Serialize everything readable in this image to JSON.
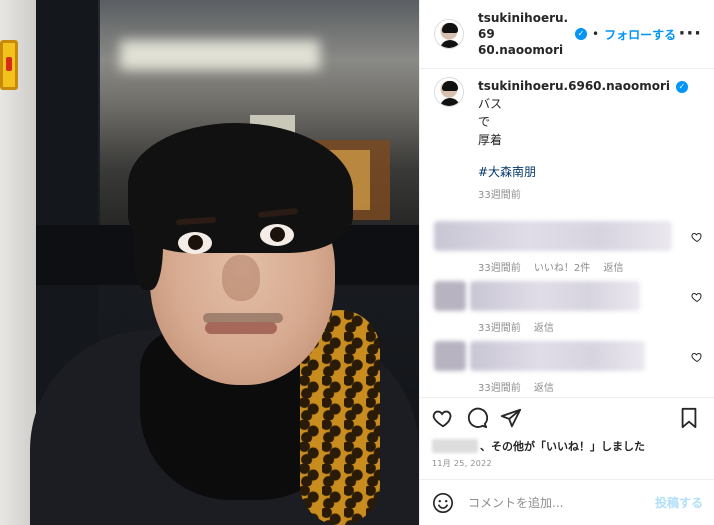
{
  "header": {
    "username_line1": "tsukinihoeru.69",
    "username_line2": "60.naoomori",
    "separator": "•",
    "follow_label": "フォローする",
    "more_label": "···"
  },
  "caption": {
    "username": "tsukinihoeru.6960.naoomori",
    "text_line1": "バス",
    "text_line2": "で",
    "text_line3": "厚着",
    "hashtag": "#大森南朋",
    "time": "33週間前"
  },
  "comments": [
    {
      "time": "33週間前",
      "likes": "いいね！2件",
      "reply": "返信"
    },
    {
      "time": "33週間前",
      "reply": "返信"
    },
    {
      "time": "33週間前",
      "reply": "返信"
    }
  ],
  "likes": {
    "text": "、その他が「いいね！」しました"
  },
  "date": "11月 25, 2022",
  "add_comment": {
    "placeholder": "コメントを追加...",
    "post_label": "投稿する"
  },
  "colors": {
    "accent": "#0095f6",
    "hashtag": "#00376b",
    "muted": "#8e8e8e",
    "post_disabled": "#b2dffc"
  },
  "icons": [
    "verified-badge-icon",
    "more-icon",
    "heart-icon",
    "comment-icon",
    "share-icon",
    "save-icon",
    "emoji-icon"
  ]
}
